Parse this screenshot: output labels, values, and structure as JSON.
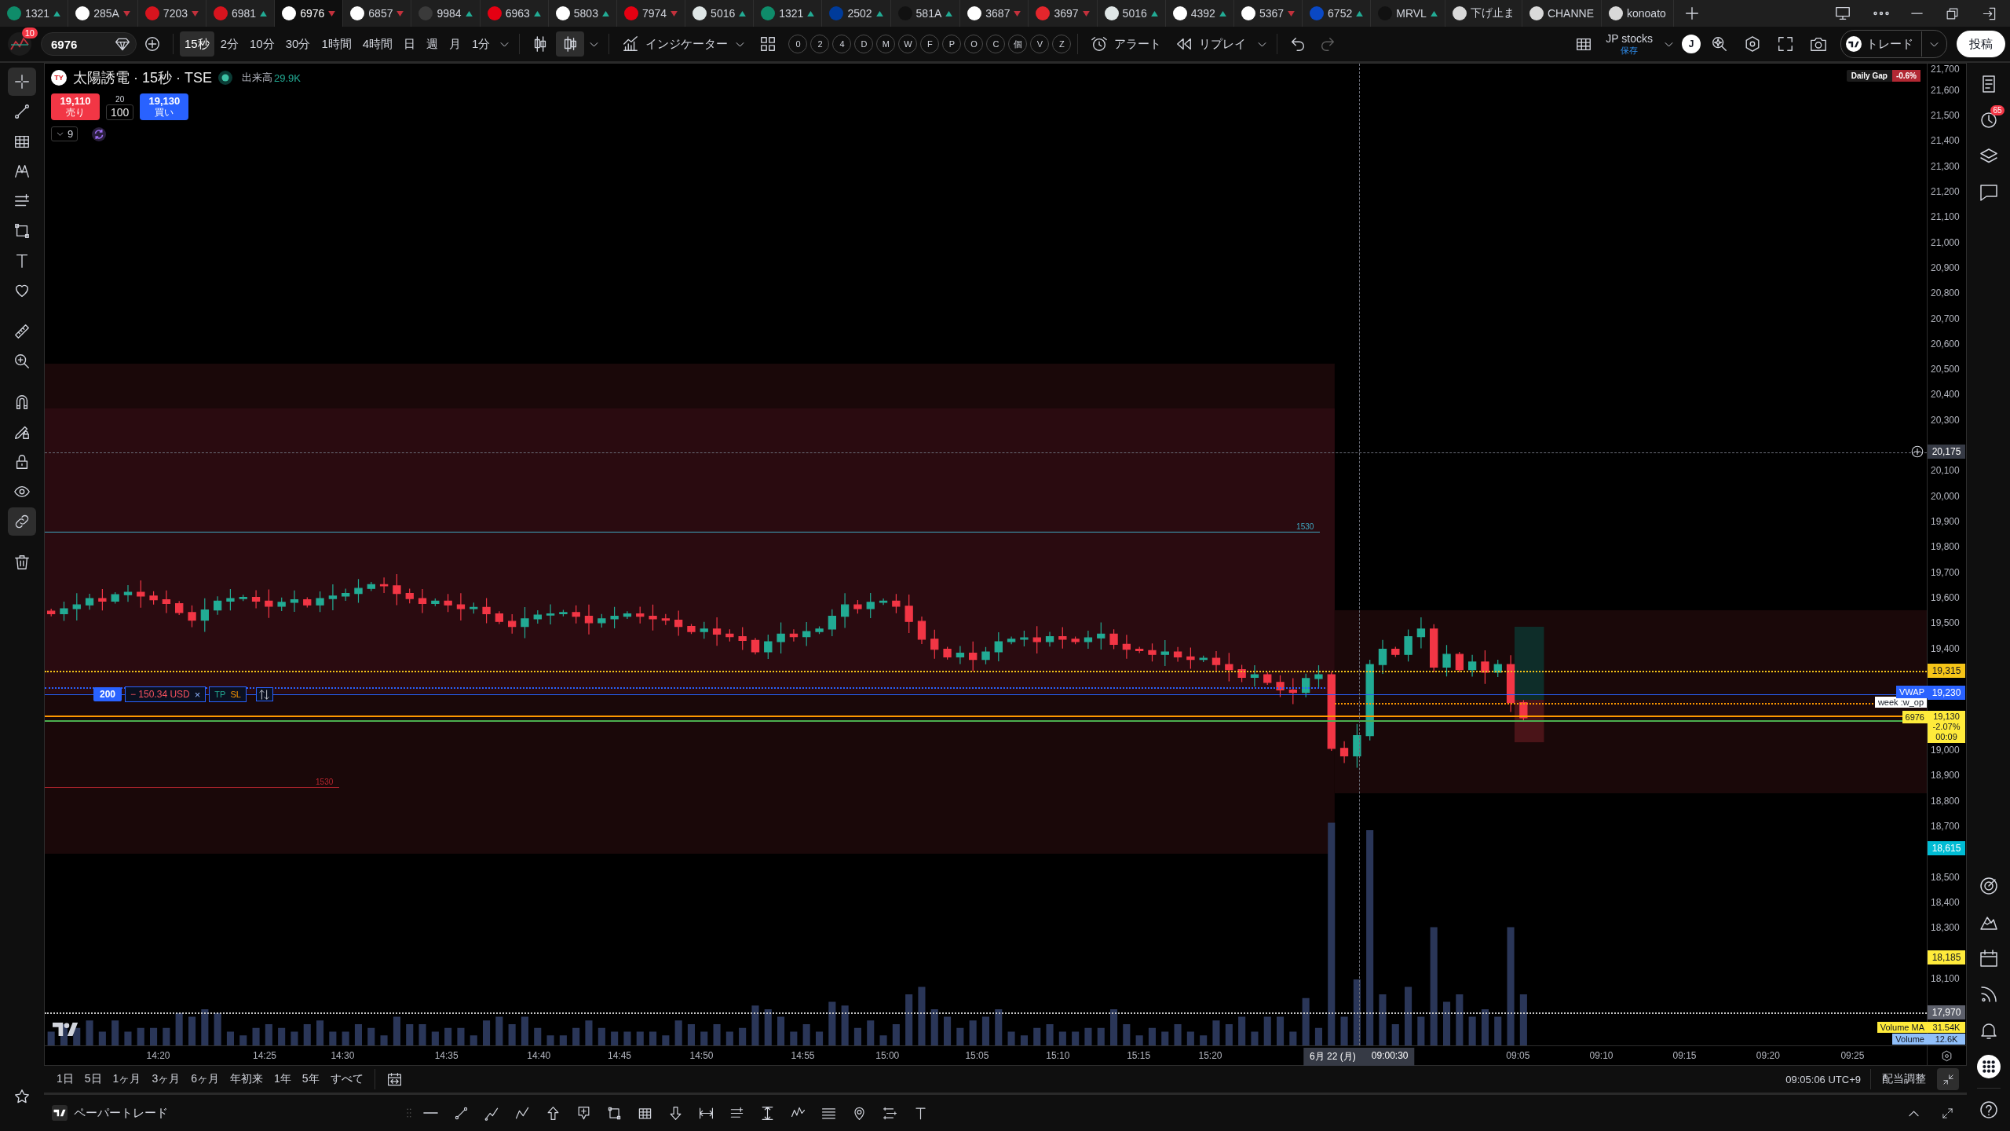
{
  "tabs": [
    {
      "symbol": "1321",
      "rising": true,
      "color": "#0f8c6a",
      "selected": false
    },
    {
      "symbol": "285A",
      "rising": false,
      "color": "#ffffff",
      "selected": false
    },
    {
      "symbol": "7203",
      "rising": false,
      "color": "#d7141e",
      "selected": false
    },
    {
      "symbol": "6981",
      "rising": true,
      "color": "#d7141e",
      "selected": false
    },
    {
      "symbol": "6976",
      "rising": false,
      "color": "#ffffff",
      "selected": true
    },
    {
      "symbol": "6857",
      "rising": false,
      "color": "#ffffff",
      "selected": false
    },
    {
      "symbol": "9984",
      "rising": true,
      "color": "#3a3a3a",
      "selected": false
    },
    {
      "symbol": "6963",
      "rising": true,
      "color": "#e50012",
      "selected": false
    },
    {
      "symbol": "5803",
      "rising": true,
      "color": "#ffffff",
      "selected": false
    },
    {
      "symbol": "7974",
      "rising": false,
      "color": "#e50012",
      "selected": false
    },
    {
      "symbol": "5016",
      "rising": true,
      "color": "#dfe6e6",
      "selected": false
    },
    {
      "symbol": "1321",
      "rising": true,
      "color": "#0f8c6a",
      "selected": false
    },
    {
      "symbol": "2502",
      "rising": true,
      "color": "#003b9a",
      "selected": false
    },
    {
      "symbol": "581A",
      "rising": true,
      "color": "#111111",
      "selected": false
    },
    {
      "symbol": "3687",
      "rising": false,
      "color": "#ffffff",
      "selected": false
    },
    {
      "symbol": "3697",
      "rising": false,
      "color": "#e4262c",
      "selected": false
    },
    {
      "symbol": "5016",
      "rising": true,
      "color": "#dfe6e6",
      "selected": false
    },
    {
      "symbol": "4392",
      "rising": true,
      "color": "#ffffff",
      "selected": false
    },
    {
      "symbol": "5367",
      "rising": false,
      "color": "#ffffff",
      "selected": false
    },
    {
      "symbol": "6752",
      "rising": true,
      "color": "#0a48c4",
      "selected": false
    },
    {
      "symbol": "MRVL",
      "rising": true,
      "color": "#111111",
      "selected": false
    },
    {
      "symbol": "下げ止ま",
      "color": "#d9d9d9",
      "selected": false
    },
    {
      "symbol": "CHANNE",
      "color": "#d9d9d9",
      "selected": false
    },
    {
      "symbol": "konoato",
      "color": "#d9d9d9",
      "selected": false
    }
  ],
  "toolbar": {
    "notifications": "10",
    "symbol": "6976",
    "intervals": [
      {
        "label": "15秒",
        "selected": true
      },
      {
        "label": "2分",
        "selected": false
      },
      {
        "label": "10分",
        "selected": false
      },
      {
        "label": "30分",
        "selected": false
      },
      {
        "label": "1時間",
        "selected": false
      },
      {
        "label": "4時間",
        "selected": false
      },
      {
        "label": "日",
        "selected": false
      },
      {
        "label": "週",
        "selected": false
      },
      {
        "label": "月",
        "selected": false
      },
      {
        "label": "1分",
        "selected": false
      }
    ],
    "chart_types": [
      {
        "kind": "candles",
        "selected": false
      },
      {
        "kind": "hollow_candles",
        "selected": true
      }
    ],
    "indicators": "インジケーター",
    "quick_buttons": [
      "0",
      "2",
      "4",
      "D",
      "M",
      "W",
      "F",
      "P",
      "O",
      "C",
      "個",
      "V",
      "Z"
    ],
    "alert": "アラート",
    "replay": "リプレイ",
    "redo_disabled": true,
    "layout_name": "JP stocks",
    "layout_status": "保存",
    "user_initial": "J",
    "trade": "トレード",
    "publish": "投稿"
  },
  "left_tools": [
    {
      "kind": "crosshair",
      "selected": true
    },
    {
      "kind": "trend_line",
      "selected": false
    },
    {
      "kind": "fib",
      "selected": false
    },
    {
      "kind": "pattern",
      "selected": false
    },
    {
      "kind": "forecast",
      "selected": false
    },
    {
      "kind": "shapes",
      "selected": false
    },
    {
      "kind": "text",
      "selected": false
    },
    {
      "kind": "favorites",
      "selected": false
    },
    {
      "kind": "measure",
      "selected": false
    },
    {
      "kind": "zoom",
      "selected": false
    },
    {
      "kind": "magnet",
      "selected": false
    },
    {
      "kind": "drawing_mode",
      "selected": false
    },
    {
      "kind": "lock",
      "selected": false
    },
    {
      "kind": "visibility",
      "selected": false
    },
    {
      "kind": "sync",
      "selected": true
    },
    {
      "kind": "remove",
      "selected": false
    }
  ],
  "chart": {
    "logo": "TY",
    "title": "太陽誘電 · 15秒 · TSE",
    "market_open": true,
    "volume_label": "出来高",
    "volume_value": "29.9K",
    "sell": {
      "price": "19,110",
      "label": "売り"
    },
    "spread": "20",
    "quantity": "100",
    "buy": {
      "price": "19,130",
      "label": "買い"
    },
    "indicator_count": "9",
    "daily_gap": {
      "label": "Daily Gap",
      "value": "-0.6%"
    },
    "level_labels": [
      "1530",
      "1530"
    ],
    "week_tag": "week :w_op",
    "order": {
      "quantity": "200",
      "pnl": "− 150.34 USD",
      "close": "×",
      "tp": "TP",
      "sl": "SL"
    },
    "crosshair": {
      "price": "20,175",
      "date": "6月 22 (月)",
      "time": "09:00:30"
    },
    "price_ticks": [
      "21,700",
      "21,600",
      "21,500",
      "21,400",
      "21,300",
      "21,200",
      "21,100",
      "21,000",
      "20,900",
      "20,800",
      "20,700",
      "20,600",
      "20,500",
      "20,400",
      "20,300",
      "20,100",
      "20,000",
      "19,900",
      "19,800",
      "19,700",
      "19,600",
      "19,500",
      "19,400",
      "19,000",
      "18,900",
      "18,800",
      "18,700",
      "18,500",
      "18,400",
      "18,300",
      "18,100"
    ],
    "price_labels": [
      {
        "kind": "plain",
        "price": "19,315",
        "color": "#f5c518"
      },
      {
        "kind": "tagged",
        "tag": "VWAP",
        "price": "19,230",
        "color": "#2962ff"
      },
      {
        "kind": "last",
        "tag": "6976",
        "price": "19,130",
        "change": "-2.07%",
        "countdown": "00:09",
        "color": "#ffeb3b"
      },
      {
        "kind": "plain",
        "price": "18,615",
        "color": "#00bcd4"
      },
      {
        "kind": "plain",
        "price": "18,185",
        "color": "#ffeb3b"
      },
      {
        "kind": "plain",
        "price": "17,970",
        "color": "#5d606b"
      },
      {
        "kind": "volume",
        "tag": "Volume MA",
        "price": "31.54K",
        "color": "#ffeb3b"
      },
      {
        "kind": "volume",
        "tag": "Volume",
        "price": "12.6K",
        "color": "#90bff9"
      }
    ],
    "time_ticks": [
      "14:20",
      "14:25",
      "14:30",
      "14:35",
      "14:40",
      "14:45",
      "14:50",
      "14:55",
      "15:00",
      "15:05",
      "15:10",
      "15:15",
      "15:20",
      "09:05",
      "09:10",
      "09:15",
      "09:20",
      "09:25"
    ]
  },
  "range_bar": {
    "ranges": [
      {
        "label": "1日",
        "selected": false
      },
      {
        "label": "5日",
        "selected": false
      },
      {
        "label": "1ヶ月",
        "selected": false
      },
      {
        "label": "3ヶ月",
        "selected": false
      },
      {
        "label": "6ヶ月",
        "selected": false
      },
      {
        "label": "年初来",
        "selected": false
      },
      {
        "label": "1年",
        "selected": false
      },
      {
        "label": "5年",
        "selected": false
      },
      {
        "label": "すべて",
        "selected": false
      }
    ],
    "clock": "09:05:06 UTC+9",
    "adjust": "配当調整"
  },
  "right_sidebar": {
    "alerts_badge": "65"
  },
  "bottom_panel": {
    "title": "ペーパートレード"
  }
}
